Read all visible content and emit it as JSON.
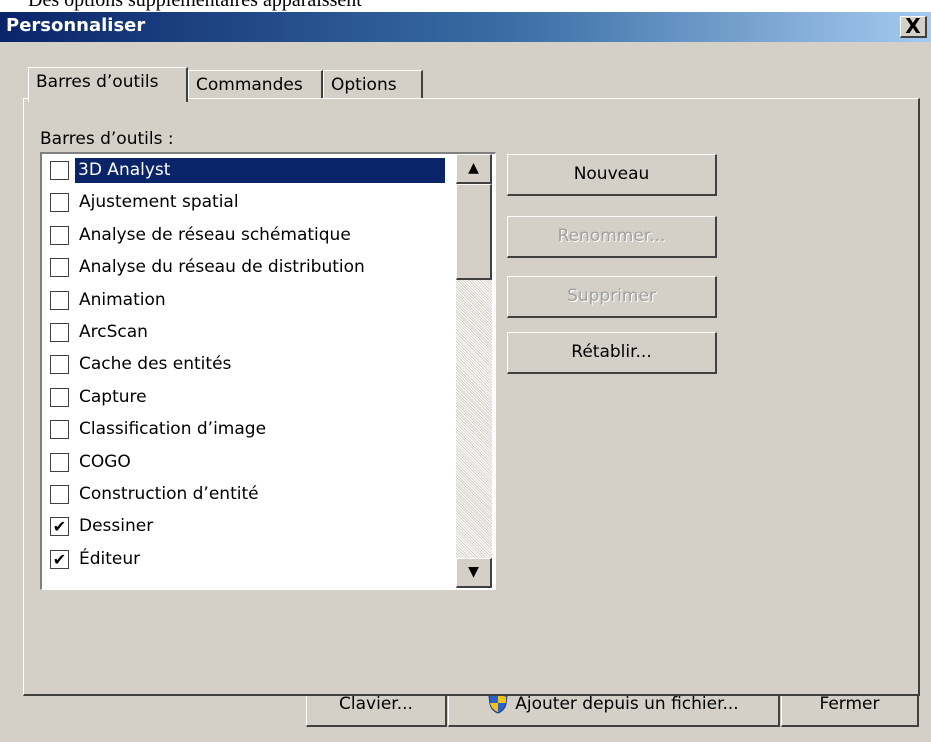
{
  "dialog": {
    "title": "Personnaliser",
    "close_label": "X"
  },
  "tabs": [
    {
      "label": "Barres d’outils",
      "active": true
    },
    {
      "label": "Commandes",
      "active": false
    },
    {
      "label": "Options",
      "active": false
    }
  ],
  "toolbars_label": "Barres d’outils :",
  "toolbars": [
    {
      "label": "3D Analyst",
      "checked": false,
      "selected": true
    },
    {
      "label": "Ajustement spatial",
      "checked": false
    },
    {
      "label": "Analyse de réseau schématique",
      "checked": false
    },
    {
      "label": "Analyse du réseau de distribution",
      "checked": false
    },
    {
      "label": "Animation",
      "checked": false
    },
    {
      "label": "ArcScan",
      "checked": false
    },
    {
      "label": "Cache des entités",
      "checked": false
    },
    {
      "label": "Capture",
      "checked": false
    },
    {
      "label": "Classification d’image",
      "checked": false
    },
    {
      "label": "COGO",
      "checked": false
    },
    {
      "label": "Construction d’entité",
      "checked": false
    },
    {
      "label": "Dessiner",
      "checked": true
    },
    {
      "label": "Éditeur",
      "checked": true
    }
  ],
  "side_buttons": {
    "new_label": "Nouveau",
    "rename_label": "Renommer...",
    "delete_label": "Supprimer",
    "reset_label": "Rétablir..."
  },
  "footer": {
    "keyboard_label": "Clavier...",
    "add_from_file_label": "Ajouter depuis un fichier...",
    "close_label": "Fermer"
  },
  "icons": {
    "checkmark": "checkmark-icon",
    "scroll_up": "scroll-up-arrow-icon",
    "scroll_down": "scroll-down-arrow-icon",
    "shield": "uac-shield-icon"
  }
}
